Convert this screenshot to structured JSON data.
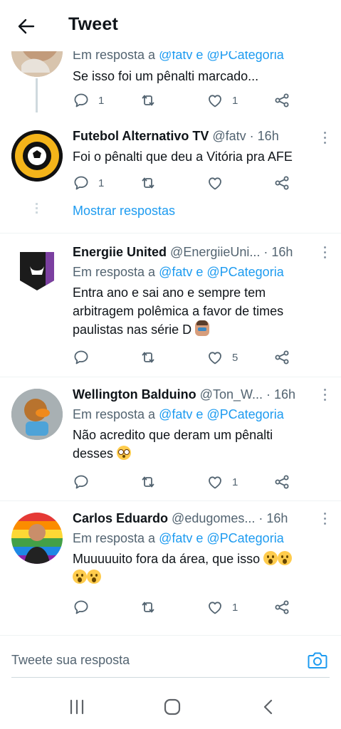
{
  "header": {
    "title": "Tweet"
  },
  "thread": {
    "partial_reply": {
      "reply_to_label": "Em resposta a",
      "reply_to_handles": "@fatv e @PCategoria",
      "text": "Se isso foi um pênalti marcado...",
      "reply_count": "1",
      "retweet_count": "",
      "like_count": "1"
    },
    "fatv": {
      "name": "Futebol Alternativo TV",
      "handle": "@fatv",
      "time": "· 16h",
      "text": "Foi o pênalti que deu a Vitória pra AFE",
      "reply_count": "1",
      "retweet_count": "",
      "like_count": ""
    },
    "show_replies": "Mostrar respostas"
  },
  "replies": [
    {
      "name": "Energiie United",
      "handle": "@EnergiieUni...",
      "time": "· 16h",
      "reply_to_label": "Em resposta a",
      "reply_to_handles": "@fatv e @PCategoria",
      "text_lines": [
        "Entra ano e sai ano e sempre tem",
        "arbitragem polêmica a favor de times",
        "paulistas nas série  D"
      ],
      "emoji": "facepalm",
      "reply_count": "",
      "retweet_count": "",
      "like_count": "5"
    },
    {
      "name": "Wellington Balduino",
      "handle": "@Ton_W...",
      "time": "· 16h",
      "reply_to_label": "Em resposta a",
      "reply_to_handles": "@fatv e @PCategoria",
      "text_lines": [
        "Não acredito que deram um pênalti",
        "desses"
      ],
      "emoji": "flushed-face",
      "reply_count": "",
      "retweet_count": "",
      "like_count": "1"
    },
    {
      "name": "Carlos Eduardo",
      "handle": "@edugomes...",
      "time": "· 16h",
      "reply_to_label": "Em resposta a",
      "reply_to_handles": "@fatv e @PCategoria",
      "text_lines": [
        "Muuuuuito fora da área, que isso"
      ],
      "emoji": "hushed-face",
      "reply_count": "",
      "retweet_count": "",
      "like_count": "1"
    }
  ],
  "composer": {
    "placeholder": "Tweete sua resposta"
  },
  "colors": {
    "accent": "#1d9bf0",
    "text": "#0f1419",
    "secondary": "#536471",
    "divider": "#eff3f4"
  },
  "icons": [
    "back-arrow-icon",
    "reply-icon",
    "retweet-icon",
    "like-icon",
    "share-icon",
    "more-icon",
    "camera-icon",
    "recents-icon",
    "home-icon",
    "nav-back-icon"
  ]
}
